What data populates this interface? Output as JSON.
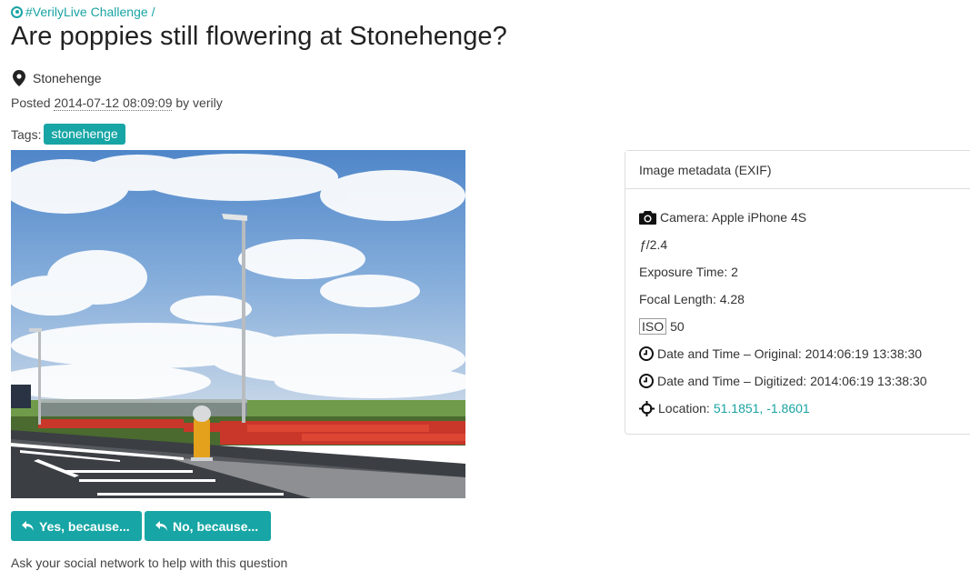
{
  "breadcrumb": {
    "challenge": "#VerilyLive Challenge",
    "separator": "/"
  },
  "question": {
    "title": "Are poppies still flowering at Stonehenge?",
    "location": "Stonehenge",
    "posted_prefix": "Posted",
    "posted_date": "2014-07-12 08:09:09",
    "posted_by": "by verily",
    "tags_label": "Tags:",
    "tags": [
      "stonehenge"
    ]
  },
  "actions": {
    "yes_label": "Yes, because...",
    "no_label": "No, because..."
  },
  "social_text": "Ask your social network to help with this question",
  "exif": {
    "heading": "Image metadata (EXIF)",
    "camera": "Camera: Apple iPhone 4S",
    "fnumber_prefix": "ƒ",
    "fnumber_value": "/2.4",
    "exposure": "Exposure Time: 2",
    "focal": "Focal Length: 4.28",
    "iso_label": "ISO",
    "iso_value": "50",
    "date_original": "Date and Time – Original: 2014:06:19 13:38:30",
    "date_digitized": "Date and Time – Digitized: 2014:06:19 13:38:30",
    "location_label": "Location:",
    "location_value": "51.1851, -1.8601"
  },
  "colors": {
    "accent": "#17a5a5",
    "link": "#1aa3a3",
    "border": "#dddddd"
  }
}
